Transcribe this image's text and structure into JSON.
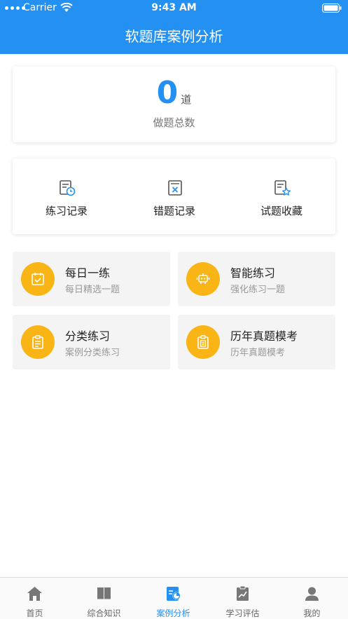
{
  "status_bar": {
    "carrier": "Carrier",
    "time": "9:43 AM"
  },
  "header": {
    "title": "软题库案例分析"
  },
  "stats": {
    "count": "0",
    "unit": "道",
    "label": "做题总数"
  },
  "records": [
    {
      "label": "练习记录",
      "icon": "practice-record-icon"
    },
    {
      "label": "错题记录",
      "icon": "wrong-questions-icon"
    },
    {
      "label": "试题收藏",
      "icon": "favorites-icon"
    }
  ],
  "practice": [
    {
      "title": "每日一练",
      "subtitle": "每日精选一题",
      "icon": "calendar-check-icon"
    },
    {
      "title": "智能练习",
      "subtitle": "强化练习一题",
      "icon": "robot-icon"
    },
    {
      "title": "分类练习",
      "subtitle": "案例分类练习",
      "icon": "clipboard-icon"
    },
    {
      "title": "历年真题模考",
      "subtitle": "历年真题模考",
      "icon": "exam-paper-icon"
    }
  ],
  "tabs": [
    {
      "label": "首页",
      "icon": "home-icon",
      "active": false
    },
    {
      "label": "综合知识",
      "icon": "book-icon",
      "active": false
    },
    {
      "label": "案例分析",
      "icon": "case-analysis-icon",
      "active": true
    },
    {
      "label": "学习评估",
      "icon": "assessment-icon",
      "active": false
    },
    {
      "label": "我的",
      "icon": "user-icon",
      "active": false
    }
  ],
  "colors": {
    "primary": "#2491f2",
    "accent": "#f9b515",
    "tile_bg": "#f4f4f4"
  }
}
